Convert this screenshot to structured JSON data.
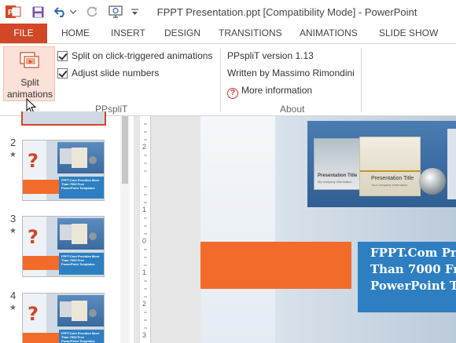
{
  "window": {
    "title": "FPPT Presentation.ppt [Compatibility Mode] - PowerPoint"
  },
  "quick_access": {
    "icons": [
      "powerpoint-logo",
      "save",
      "undo",
      "undo-dropdown",
      "redo",
      "start-from-beginning",
      "customize"
    ]
  },
  "tabs": [
    {
      "label": "FILE",
      "active": true
    },
    {
      "label": "HOME"
    },
    {
      "label": "INSERT"
    },
    {
      "label": "DESIGN"
    },
    {
      "label": "TRANSITIONS"
    },
    {
      "label": "ANIMATIONS"
    },
    {
      "label": "SLIDE SHOW"
    }
  ],
  "ribbon": {
    "ppsplit_group": {
      "split_button_line1": "Split",
      "split_button_line2": "animations",
      "option1": "Split on click-triggered animations",
      "option2": "Adjust slide numbers",
      "label": "PPspliT"
    },
    "about_group": {
      "version": "PPspliT  version 1.13",
      "author": "Written by Massimo Rimondini",
      "more_info": "More information",
      "label": "About"
    }
  },
  "thumbnails": [
    {
      "number": "2",
      "text_lines": [
        "FPPT.Com Provides More",
        "Than 7000 Free",
        "PowerPoint Templates"
      ]
    },
    {
      "number": "3",
      "text_lines": [
        "FPPT.Com Provides More",
        "Than 7000 Free",
        "PowerPoint Templates"
      ]
    },
    {
      "number": "4",
      "text_lines": [
        "FPPT.Com Provides More",
        "Than 7000 Free",
        "PowerPoint Templates"
      ]
    }
  ],
  "ruler": {
    "labels": [
      "2",
      "1",
      "0",
      "1",
      "2",
      "3"
    ]
  },
  "slide": {
    "mini_slide_a_title": "Presentation Title",
    "mini_slide_a_subtitle": "My company information",
    "mini_slide_b_title": "Presentation Title",
    "mini_slide_b_subtitle": "Your company information",
    "main_text_lines": [
      "FPPT.Com Pro",
      "Than 7000 Fr",
      "PowerPoint T"
    ]
  },
  "colors": {
    "accent": "#d24726",
    "orange_block": "#f26b2a",
    "blue_block": "#2e7fc1"
  }
}
